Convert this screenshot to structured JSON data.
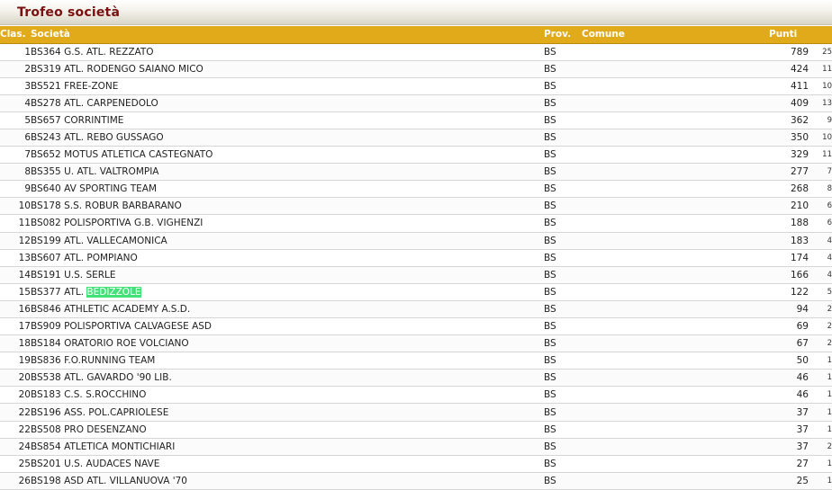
{
  "page": {
    "title": "Trofeo società"
  },
  "table": {
    "headers": {
      "rank": "Clas.",
      "society": "Società",
      "province": "Prov.",
      "comune": "Comune",
      "points": "Punti"
    },
    "rows": [
      {
        "rank": "1",
        "code": "BS364",
        "name": "G.S. ATL. REZZATO",
        "prov": "BS",
        "comune": "",
        "points": "789",
        "n": "25"
      },
      {
        "rank": "2",
        "code": "BS319",
        "name": "ATL. RODENGO SAIANO MICO",
        "prov": "BS",
        "comune": "",
        "points": "424",
        "n": "11"
      },
      {
        "rank": "3",
        "code": "BS521",
        "name": "FREE-ZONE",
        "prov": "BS",
        "comune": "",
        "points": "411",
        "n": "10"
      },
      {
        "rank": "4",
        "code": "BS278",
        "name": "ATL. CARPENEDOLO",
        "prov": "BS",
        "comune": "",
        "points": "409",
        "n": "13"
      },
      {
        "rank": "5",
        "code": "BS657",
        "name": "CORRINTIME",
        "prov": "BS",
        "comune": "",
        "points": "362",
        "n": "9"
      },
      {
        "rank": "6",
        "code": "BS243",
        "name": "ATL. REBO GUSSAGO",
        "prov": "BS",
        "comune": "",
        "points": "350",
        "n": "10"
      },
      {
        "rank": "7",
        "code": "BS652",
        "name": "MOTUS ATLETICA CASTEGNATO",
        "prov": "BS",
        "comune": "",
        "points": "329",
        "n": "11"
      },
      {
        "rank": "8",
        "code": "BS355",
        "name": "U. ATL. VALTROMPIA",
        "prov": "BS",
        "comune": "",
        "points": "277",
        "n": "7"
      },
      {
        "rank": "9",
        "code": "BS640",
        "name": "AV SPORTING TEAM",
        "prov": "BS",
        "comune": "",
        "points": "268",
        "n": "8"
      },
      {
        "rank": "10",
        "code": "BS178",
        "name": "S.S. ROBUR BARBARANO",
        "prov": "BS",
        "comune": "",
        "points": "210",
        "n": "6"
      },
      {
        "rank": "11",
        "code": "BS082",
        "name": "POLISPORTIVA G.B. VIGHENZI",
        "prov": "BS",
        "comune": "",
        "points": "188",
        "n": "6"
      },
      {
        "rank": "12",
        "code": "BS199",
        "name": "ATL. VALLECAMONICA",
        "prov": "BS",
        "comune": "",
        "points": "183",
        "n": "4"
      },
      {
        "rank": "13",
        "code": "BS607",
        "name": "ATL. POMPIANO",
        "prov": "BS",
        "comune": "",
        "points": "174",
        "n": "4"
      },
      {
        "rank": "14",
        "code": "BS191",
        "name": "U.S. SERLE",
        "prov": "BS",
        "comune": "",
        "points": "166",
        "n": "4"
      },
      {
        "rank": "15",
        "code": "BS377",
        "name": "ATL.",
        "highlight": "BEDIZZOLE",
        "prov": "BS",
        "comune": "",
        "points": "122",
        "n": "5"
      },
      {
        "rank": "16",
        "code": "BS846",
        "name": "ATHLETIC ACADEMY A.S.D.",
        "prov": "BS",
        "comune": "",
        "points": "94",
        "n": "2"
      },
      {
        "rank": "17",
        "code": "BS909",
        "name": "POLISPORTIVA CALVAGESE ASD",
        "prov": "BS",
        "comune": "",
        "points": "69",
        "n": "2"
      },
      {
        "rank": "18",
        "code": "BS184",
        "name": "ORATORIO ROE VOLCIANO",
        "prov": "BS",
        "comune": "",
        "points": "67",
        "n": "2"
      },
      {
        "rank": "19",
        "code": "BS836",
        "name": "F.O.RUNNING TEAM",
        "prov": "BS",
        "comune": "",
        "points": "50",
        "n": "1"
      },
      {
        "rank": "20",
        "code": "BS538",
        "name": "ATL. GAVARDO '90 LIB.",
        "prov": "BS",
        "comune": "",
        "points": "46",
        "n": "1"
      },
      {
        "rank": "20",
        "code": "BS183",
        "name": "C.S. S.ROCCHINO",
        "prov": "BS",
        "comune": "",
        "points": "46",
        "n": "1"
      },
      {
        "rank": "22",
        "code": "BS196",
        "name": "ASS. POL.CAPRIOLESE",
        "prov": "BS",
        "comune": "",
        "points": "37",
        "n": "1"
      },
      {
        "rank": "22",
        "code": "BS508",
        "name": "PRO DESENZANO",
        "prov": "BS",
        "comune": "",
        "points": "37",
        "n": "1"
      },
      {
        "rank": "24",
        "code": "BS854",
        "name": "ATLETICA MONTICHIARI",
        "prov": "BS",
        "comune": "",
        "points": "37",
        "n": "2"
      },
      {
        "rank": "25",
        "code": "BS201",
        "name": "U.S. AUDACES NAVE",
        "prov": "BS",
        "comune": "",
        "points": "27",
        "n": "1"
      },
      {
        "rank": "26",
        "code": "BS198",
        "name": "ASD ATL. VILLANUOVA '70",
        "prov": "BS",
        "comune": "",
        "points": "25",
        "n": "1"
      }
    ]
  }
}
